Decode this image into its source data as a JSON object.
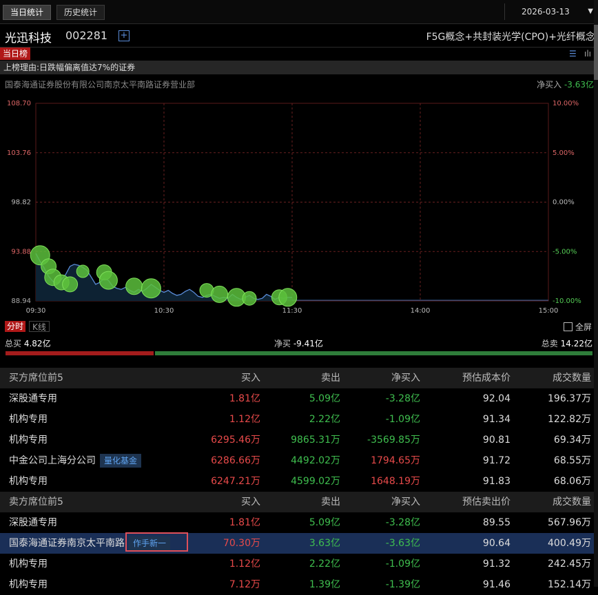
{
  "tabs": {
    "today": "当日统计",
    "history": "历史统计"
  },
  "date": {
    "value": "2026-03-13",
    "arrow": "▼"
  },
  "stock": {
    "name": "光迅科技",
    "code": "002281",
    "add_symbol": "+",
    "concepts": "F5G概念+共封装光学(CPO)+光纤概念"
  },
  "list_tab": "当日榜",
  "reason": "上榜理由:日跌幅偏离值达7%的证券",
  "broker": {
    "name": "国泰海通证券股份有限公司南京太平南路证券营业部",
    "net_label": "净买入",
    "net_value": "-3.63亿"
  },
  "chart_data": {
    "type": "line",
    "y_left_ticks": [
      "108.70",
      "103.76",
      "98.82",
      "93.88",
      "88.94"
    ],
    "y_right_ticks": [
      "10.00%",
      "5.00%",
      "0.00%",
      "-5.00%",
      "-10.00%"
    ],
    "x_ticks": [
      "09:30",
      "10:30",
      "11:30",
      "14:00",
      "15:00"
    ],
    "ylim": [
      88.94,
      108.7
    ],
    "series": [
      {
        "x": [
          0,
          2,
          4,
          6,
          8,
          10,
          12,
          14,
          16,
          18,
          20,
          22,
          24,
          26,
          28,
          30,
          32,
          34,
          36,
          38,
          40,
          42,
          44,
          46,
          48,
          50,
          52,
          54,
          56,
          58,
          60,
          62,
          64,
          66,
          68,
          70,
          72,
          74,
          76,
          78,
          80,
          82,
          84,
          86,
          88,
          90,
          92,
          94,
          96,
          98,
          100,
          102,
          104,
          106,
          108,
          110,
          112,
          114,
          116,
          118,
          120
        ],
        "y": [
          93.7,
          92.9,
          92.2,
          91.4,
          90.9,
          90.7,
          91.1,
          91.6,
          92.4,
          92.6,
          92.5,
          92.3,
          92.0,
          91.3,
          90.6,
          90.8,
          91.2,
          91.0,
          90.4,
          90.2,
          90.1,
          90.3,
          90.0,
          89.8,
          90.1,
          89.9,
          90.2,
          90.6,
          90.3,
          90.0,
          89.8,
          90.0,
          89.7,
          89.5,
          89.6,
          89.9,
          90.1,
          89.8,
          89.4,
          89.3,
          89.5,
          89.6,
          89.4,
          89.2,
          89.3,
          89.2,
          89.6,
          89.3,
          89.1,
          89.3,
          89.5,
          89.2,
          89.1,
          89.2,
          89.6,
          89.4,
          89.1,
          89.3,
          89.2,
          89.3,
          89.3
        ]
      }
    ],
    "bubbles": [
      {
        "x": 2,
        "y": 93.5,
        "s": 14
      },
      {
        "x": 6,
        "y": 92.4,
        "s": 11
      },
      {
        "x": 8,
        "y": 91.3,
        "s": 12
      },
      {
        "x": 12,
        "y": 90.8,
        "s": 11
      },
      {
        "x": 16,
        "y": 90.6,
        "s": 11
      },
      {
        "x": 22,
        "y": 91.9,
        "s": 9
      },
      {
        "x": 32,
        "y": 91.8,
        "s": 11
      },
      {
        "x": 34,
        "y": 91.0,
        "s": 13
      },
      {
        "x": 46,
        "y": 90.4,
        "s": 12
      },
      {
        "x": 54,
        "y": 90.2,
        "s": 14
      },
      {
        "x": 80,
        "y": 90.0,
        "s": 10
      },
      {
        "x": 86,
        "y": 89.6,
        "s": 12
      },
      {
        "x": 94,
        "y": 89.3,
        "s": 13
      },
      {
        "x": 100,
        "y": 89.2,
        "s": 10
      },
      {
        "x": 114,
        "y": 89.3,
        "s": 11
      },
      {
        "x": 118,
        "y": 89.3,
        "s": 13
      }
    ]
  },
  "chart_controls": {
    "fenshi": "分时",
    "kline": "K线",
    "fullscreen": "全屏"
  },
  "summary": {
    "buy_label": "总买",
    "buy_value": "4.82亿",
    "net_label": "净买",
    "net_value": "-9.41亿",
    "sell_label": "总卖",
    "sell_value": "14.22亿",
    "buy_ratio": 0.254
  },
  "buy_table": {
    "headers": [
      "买方席位前5",
      "买入",
      "卖出",
      "净买入",
      "预估成本价",
      "成交数量"
    ],
    "rows": [
      {
        "name": "深股通专用",
        "tag": "",
        "buy": "1.81亿",
        "sell": "5.09亿",
        "net": "-3.28亿",
        "price": "92.04",
        "vol": "196.37万"
      },
      {
        "name": "机构专用",
        "tag": "",
        "buy": "1.12亿",
        "sell": "2.22亿",
        "net": "-1.09亿",
        "price": "91.34",
        "vol": "122.82万"
      },
      {
        "name": "机构专用",
        "tag": "",
        "buy": "6295.46万",
        "sell": "9865.31万",
        "net": "-3569.85万",
        "price": "90.81",
        "vol": "69.34万"
      },
      {
        "name": "中金公司上海分公司",
        "tag": "量化基金",
        "buy": "6286.66万",
        "sell": "4492.02万",
        "net": "1794.65万",
        "price": "91.72",
        "vol": "68.55万"
      },
      {
        "name": "机构专用",
        "tag": "",
        "buy": "6247.21万",
        "sell": "4599.02万",
        "net": "1648.19万",
        "price": "91.83",
        "vol": "68.06万"
      }
    ]
  },
  "sell_table": {
    "headers": [
      "卖方席位前5",
      "买入",
      "卖出",
      "净买入",
      "预估卖出价",
      "成交数量"
    ],
    "rows": [
      {
        "name": "深股通专用",
        "tag": "",
        "buy": "1.81亿",
        "sell": "5.09亿",
        "net": "-3.28亿",
        "price": "89.55",
        "vol": "567.96万"
      },
      {
        "name": "国泰海通证券南京太平南路",
        "tag": "作手新一",
        "buy": "70.30万",
        "sell": "3.63亿",
        "net": "-3.63亿",
        "price": "90.64",
        "vol": "400.49万"
      },
      {
        "name": "机构专用",
        "tag": "",
        "buy": "1.12亿",
        "sell": "2.22亿",
        "net": "-1.09亿",
        "price": "91.32",
        "vol": "242.45万"
      },
      {
        "name": "机构专用",
        "tag": "",
        "buy": "7.12万",
        "sell": "1.39亿",
        "net": "-1.39亿",
        "price": "91.46",
        "vol": "152.14万"
      }
    ]
  },
  "colors": {
    "up": "#e84a4a",
    "down": "#3fbf4f",
    "accent": "#b01818",
    "line": "#5a8cd8"
  }
}
